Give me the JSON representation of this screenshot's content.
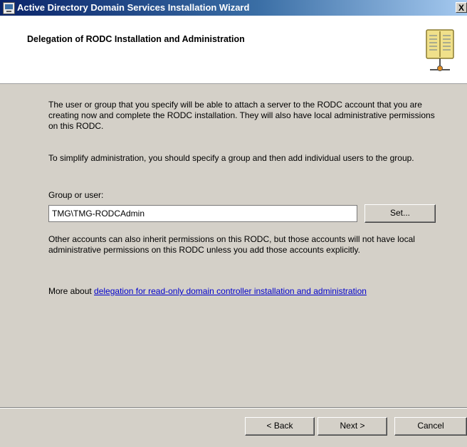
{
  "window": {
    "title": "Active Directory Domain Services Installation Wizard",
    "close_label": "X"
  },
  "header": {
    "title": "Delegation of RODC Installation and Administration",
    "icon": "book-directory-icon"
  },
  "main": {
    "intro_text": "The user or group that you specify will be able to attach a server to the RODC account that you are creating now and complete the RODC installation. They will also have local administrative permissions on this RODC.",
    "simplify_text": "To simplify administration, you should specify a group and then add individual users to the group.",
    "group_label": "Group or user:",
    "group_value": "TMG\\TMG-RODCAdmin",
    "set_button": "Set...",
    "inherit_text": "Other accounts can also inherit permissions on this RODC, but those accounts will not have local administrative permissions on this RODC unless you add those accounts explicitly.",
    "more_prefix": "More about ",
    "more_link": "delegation for read-only domain controller installation and administration"
  },
  "footer": {
    "back": "< Back",
    "next": "Next >",
    "cancel": "Cancel"
  }
}
